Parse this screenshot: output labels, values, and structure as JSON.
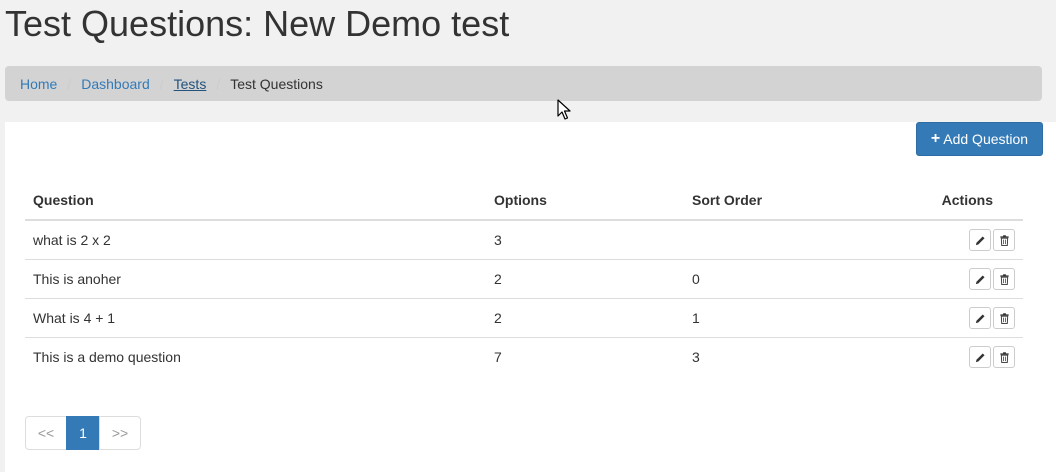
{
  "page": {
    "title": "Test Questions: New Demo test"
  },
  "breadcrumb": {
    "items": [
      {
        "label": "Home"
      },
      {
        "label": "Dashboard"
      },
      {
        "label": "Tests"
      },
      {
        "label": "Test Questions"
      }
    ],
    "separator": "/"
  },
  "toolbar": {
    "add_label": "Add Question",
    "add_icon": "plus-icon"
  },
  "table": {
    "headers": [
      "Question",
      "Options",
      "Sort Order",
      "Actions"
    ],
    "rows": [
      {
        "question": "what is 2 x 2",
        "options": "3",
        "sort_order": ""
      },
      {
        "question": "This is anoher",
        "options": "2",
        "sort_order": "0"
      },
      {
        "question": "What is 4 + 1",
        "options": "2",
        "sort_order": "1"
      },
      {
        "question": "This is a demo question",
        "options": "7",
        "sort_order": "3"
      }
    ],
    "row_actions": [
      "pencil-icon",
      "trash-icon"
    ]
  },
  "pagination": {
    "prev": "<<",
    "current": "1",
    "next": ">>"
  },
  "colors": {
    "primary": "#337ab7",
    "breadcrumb_bg": "#d3d3d3",
    "page_bg": "#f1f1f1"
  }
}
